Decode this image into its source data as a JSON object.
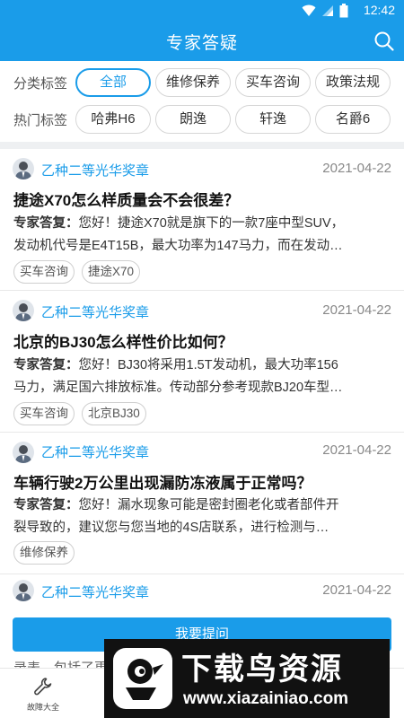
{
  "status_bar": {
    "time": "12:42"
  },
  "header": {
    "title": "专家答疑"
  },
  "filters": {
    "category_label": "分类标签",
    "category_tags": [
      "全部",
      "维修保养",
      "买车咨询",
      "政策法规"
    ],
    "hot_label": "热门标签",
    "hot_tags": [
      "哈弗H6",
      "朗逸",
      "轩逸",
      "名爵6"
    ]
  },
  "questions": [
    {
      "author": "乙种二等光华奖章",
      "date": "2021-04-22",
      "title": "捷途X70怎么样质量会不会很差？",
      "answer_label": "专家答复：",
      "answer_line1": "您好！捷途X70就是旗下的一款7座中型SUV，",
      "answer_line2": "发动机代号是E4T15B，最大功率为147马力，而在发动…",
      "tags": [
        "买车咨询",
        "捷途X70"
      ]
    },
    {
      "author": "乙种二等光华奖章",
      "date": "2021-04-22",
      "title": "北京的BJ30怎么样性价比如何？",
      "answer_label": "专家答复：",
      "answer_line1": "您好！BJ30将采用1.5T发动机，最大功率156",
      "answer_line2": "马力，满足国六排放标准。传动部分参考现款BJ20车型…",
      "tags": [
        "买车咨询",
        "北京BJ30"
      ]
    },
    {
      "author": "乙种二等光华奖章",
      "date": "2021-04-22",
      "title": "车辆行驶2万公里出现漏防冻液属于正常吗？",
      "answer_label": "专家答复：",
      "answer_line1": "您好！漏水现象可能是密封圈老化或者部件开",
      "answer_line2": "裂导致的，建议您与您当地的4S店联系，进行检测与…",
      "tags": [
        "维修保养"
      ]
    },
    {
      "author": "乙种二等光华奖章",
      "date": "2021-04-22"
    }
  ],
  "ask_button": "我要提问",
  "peek_text": "录表，包括了更",
  "bottom_nav": {
    "fault_label": "故障大全"
  },
  "watermark": {
    "title": "下载鸟资源",
    "url": "www.xiazainiao.com"
  }
}
